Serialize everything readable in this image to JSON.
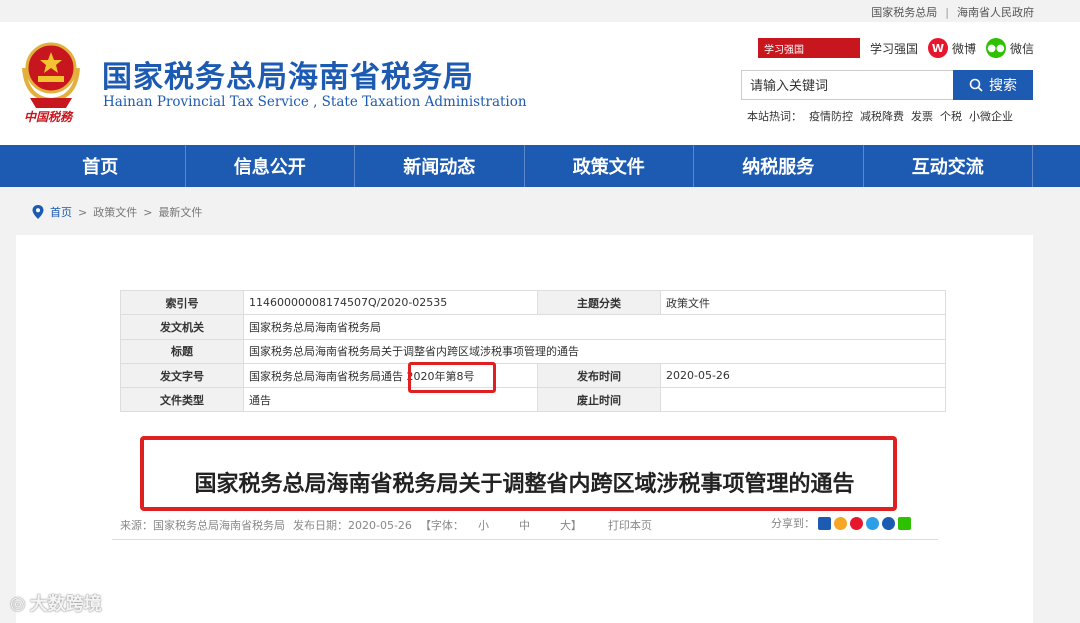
{
  "toplinks": {
    "sat": "国家税务总局",
    "gov": "海南省人民政府"
  },
  "header": {
    "title": "国家税务总局海南省税务局",
    "subtitle_en": "Hainan Provincial Tax Service , State Taxation Administration",
    "emblem_caption": "中国税務"
  },
  "social": {
    "xuexi_logo": "学习强国",
    "xuexi": "学习强国",
    "weibo": "微博",
    "wechat": "微信"
  },
  "search": {
    "placeholder": "请输入关键词",
    "button": "搜索"
  },
  "hot": {
    "label": "本站热词：",
    "words": [
      "疫情防控",
      "减税降费",
      "发票",
      "个税",
      "小微企业"
    ]
  },
  "nav": [
    "首页",
    "信息公开",
    "新闻动态",
    "政策文件",
    "纳税服务",
    "互动交流"
  ],
  "breadcrumb": [
    "首页",
    "政策文件",
    "最新文件"
  ],
  "meta": {
    "index_no_label": "索引号",
    "index_no": "11460000008174507Q/2020-02535",
    "topic_label": "主题分类",
    "topic": "政策文件",
    "issuer_label": "发文机关",
    "issuer": "国家税务总局海南省税务局",
    "title_label": "标题",
    "title": "国家税务总局海南省税务局关于调整省内跨区域涉税事项管理的通告",
    "doc_no_label": "发文字号",
    "doc_no": "国家税务总局海南省税务局通告 2020年第8号",
    "pub_label": "发布时间",
    "pub": "2020-05-26",
    "type_label": "文件类型",
    "type": "通告",
    "abolish_label": "废止时间",
    "abolish": ""
  },
  "doc": {
    "title": "国家税务总局海南省税务局关于调整省内跨区域涉税事项管理的通告",
    "source": "来源：国家税务总局海南省税务局",
    "date": "发布日期：2020-05-26",
    "font_label": "【字体：",
    "font_small": "小",
    "font_mid": "中",
    "font_large": "大】",
    "print": "打印本页",
    "share": "分享到："
  },
  "watermark": "大数跨境",
  "colors": {
    "brand_blue": "#1d5bb2",
    "highlight_red": "#e02020"
  }
}
